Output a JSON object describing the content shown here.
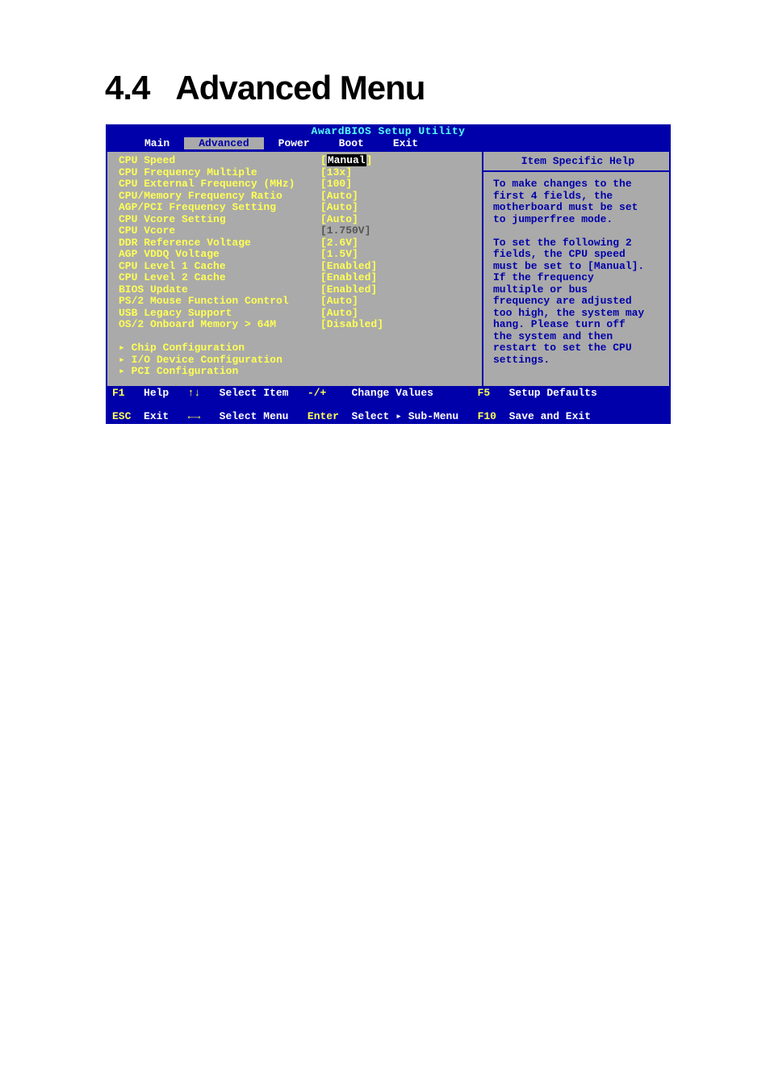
{
  "page": {
    "section_number": "4.4",
    "section_title": "Advanced Menu"
  },
  "bios": {
    "title": "AwardBIOS Setup Utility",
    "tabs": {
      "main": "Main",
      "advanced": "Advanced",
      "power": "Power",
      "boot": "Boot",
      "exit": "Exit"
    },
    "settings": [
      {
        "label": "CPU Speed",
        "value": "Manual",
        "selected": true
      },
      {
        "label": "CPU Frequency Multiple",
        "value": "[13x]"
      },
      {
        "label": "CPU External Frequency (MHz)",
        "value": "[100]"
      },
      {
        "label": "CPU/Memory Frequency Ratio",
        "value": "[Auto]"
      },
      {
        "label": "AGP/PCI Frequency Setting",
        "value": "[Auto]"
      },
      {
        "label": "CPU Vcore Setting",
        "value": "[Auto]"
      },
      {
        "label": "CPU Vcore",
        "value": "[1.750V]",
        "dim": true
      },
      {
        "label": "DDR Reference Voltage",
        "value": "[2.6V]"
      },
      {
        "label": "AGP VDDQ Voltage",
        "value": "[1.5V]"
      },
      {
        "label": "CPU Level 1 Cache",
        "value": "[Enabled]"
      },
      {
        "label": "CPU Level 2 Cache",
        "value": "[Enabled]"
      },
      {
        "label": "BIOS Update",
        "value": "[Enabled]"
      },
      {
        "label": "PS/2 Mouse Function Control",
        "value": "[Auto]"
      },
      {
        "label": "USB Legacy Support",
        "value": "[Auto]"
      },
      {
        "label": "OS/2 Onboard Memory > 64M",
        "value": "[Disabled]"
      }
    ],
    "submenus": [
      "Chip Configuration",
      "I/O Device Configuration",
      "PCI Configuration"
    ],
    "help": {
      "title": "Item Specific Help",
      "lines": [
        "To make changes to the",
        "first 4 fields, the",
        "motherboard must be set",
        "to jumperfree mode.",
        "",
        "To set the following 2",
        "fields, the CPU speed",
        "must be set to [Manual].",
        "If the frequency",
        "multiple or bus",
        "frequency are adjusted",
        "too high, the system may",
        "hang. Please turn off",
        "the system and then",
        "restart to set the CPU",
        "settings."
      ]
    },
    "footer": {
      "f1": "F1",
      "help": "Help",
      "updown": "↑↓",
      "select_item": "Select Item",
      "minusplus": "-/+",
      "change_values": "Change Values",
      "f5": "F5",
      "setup_defaults": "Setup Defaults",
      "esc": "ESC",
      "exit": "Exit",
      "leftright": "←→",
      "select_menu": "Select Menu",
      "enter": "Enter",
      "select_submenu": "Select ▸ Sub-Menu",
      "f10": "F10",
      "save_exit": "Save and Exit"
    }
  }
}
